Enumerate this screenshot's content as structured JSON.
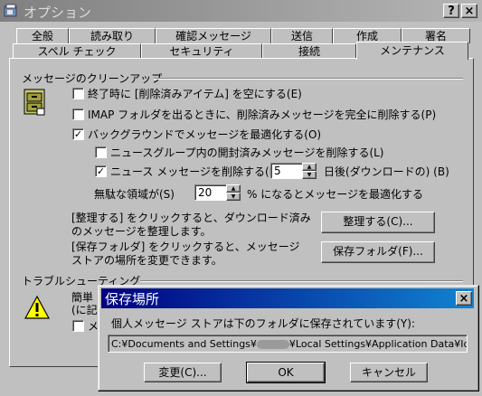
{
  "window": {
    "title": "オプション",
    "help_label": "?",
    "close_label": "×"
  },
  "tabs_row1": [
    {
      "label": "全般"
    },
    {
      "label": "読み取り"
    },
    {
      "label": "確認メッセージ"
    },
    {
      "label": "送信"
    },
    {
      "label": "作成"
    },
    {
      "label": "署名"
    }
  ],
  "tabs_row2": [
    {
      "label": "スペル チェック"
    },
    {
      "label": "セキュリティ"
    },
    {
      "label": "接続"
    },
    {
      "label": "メンテナンス"
    }
  ],
  "cleanup": {
    "group_label": "メッセージのクリーンアップ",
    "empty_deleted_label": "終了時に [削除済みアイテム] を空にする(E)",
    "empty_deleted_checked": false,
    "imap_purge_label": "IMAP フォルダを出るときに、削除済みメッセージを完全に削除する(P)",
    "imap_purge_checked": false,
    "compact_bg_label": "バックグラウンドでメッセージを最適化する(O)",
    "compact_bg_checked": true,
    "delete_read_news_label": "ニュースグループ内の開封済みメッセージを削除する(L)",
    "delete_read_news_checked": false,
    "delete_news_label": "ニュース メッセージを削除する(D)",
    "delete_news_checked": true,
    "delete_news_days": "5",
    "delete_news_suffix": "日後(ダウンロードの) (B)",
    "wasted_space_label": "無駄な領域が(S)",
    "wasted_space_value": "20",
    "wasted_space_suffix": "% になるとメッセージを最適化する",
    "cleanup_text": "[整理する] をクリックすると、ダウンロード済みのメッセージを整理します。",
    "cleanup_button": "整理する(C)...",
    "store_text": "[保存フォルダ] をクリックすると、メッセージ ストアの場所を変更できます。",
    "store_button": "保存フォルダ(F)..."
  },
  "troubleshooting": {
    "group_label": "トラブルシューティング",
    "text_partial": "簡単",
    "text_partial2": "(に記録",
    "checkbox_partial": "メ",
    "checkbox_checked": false
  },
  "dialog": {
    "title": "保存場所",
    "close_label": "×",
    "description": "個人メッセージ ストアは下のフォルダに保存されています(Y):",
    "path_start": "C:¥Documents and Settings¥",
    "path_end": "¥Local Settings¥Application Data¥Identi",
    "change_button": "変更(C)...",
    "ok_button": "OK",
    "cancel_button": "キャンセル"
  }
}
